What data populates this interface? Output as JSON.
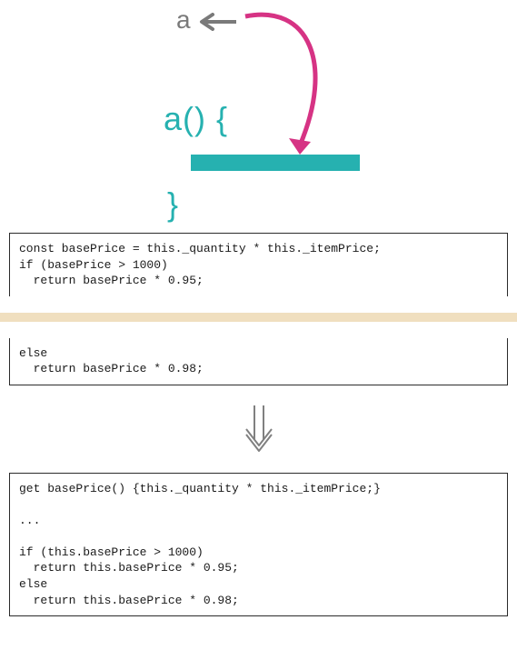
{
  "diagram": {
    "a_label": "a",
    "a_call": "a() {",
    "brace_close": "}"
  },
  "code_before_top": "const basePrice = this._quantity * this._itemPrice;\nif (basePrice > 1000)\n  return basePrice * 0.95;",
  "code_before_bottom": "else\n  return basePrice * 0.98;",
  "code_after": "get basePrice() {this._quantity * this._itemPrice;}\n\n...\n\nif (this.basePrice > 1000)\n  return this.basePrice * 0.95;\nelse\n  return this.basePrice * 0.98;"
}
